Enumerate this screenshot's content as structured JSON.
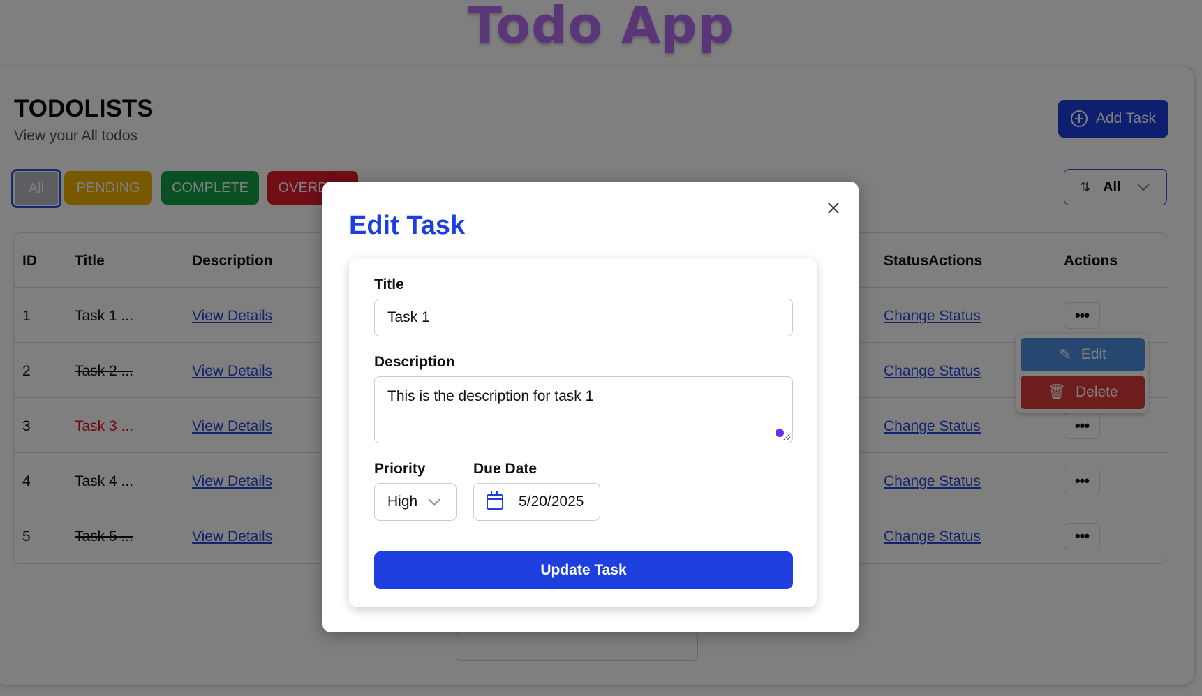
{
  "app_title": "Todo App",
  "page": {
    "heading": "TODOLISTS",
    "subheading": "View your All todos",
    "add_task_label": "Add Task"
  },
  "filters": [
    {
      "label": "All",
      "color": "#b9bcc4"
    },
    {
      "label": "PENDING",
      "color": "#f1b300"
    },
    {
      "label": "COMPLETE",
      "color": "#12a34a"
    },
    {
      "label": "OVERDUE",
      "color": "#e21c2c"
    }
  ],
  "sort": {
    "value": "All",
    "icon": "sort-icon"
  },
  "table": {
    "headers": {
      "id": "ID",
      "title": "Title",
      "description": "Description",
      "status_actions": "StatusActions",
      "actions": "Actions"
    },
    "rows": [
      {
        "id": "1",
        "title": "Task 1 ...",
        "description_link": "View Details",
        "status_link": "Change Status",
        "style": "normal"
      },
      {
        "id": "2",
        "title": "Task 2 ...",
        "description_link": "View Details",
        "status_link": "Change Status",
        "style": "strike"
      },
      {
        "id": "3",
        "title": "Task 3 ...",
        "description_link": "View Details",
        "status_link": "Change Status",
        "style": "overdue"
      },
      {
        "id": "4",
        "title": "Task 4 ...",
        "description_link": "View Details",
        "status_link": "Change Status",
        "style": "normal"
      },
      {
        "id": "5",
        "title": "Task 5 ...",
        "description_link": "View Details",
        "status_link": "Change Status",
        "style": "strike"
      }
    ],
    "row_actions_label": "•••"
  },
  "context_menu": {
    "edit_label": "Edit",
    "delete_label": "Delete"
  },
  "modal": {
    "title": "Edit Task",
    "title_label": "Title",
    "title_value": "Task 1",
    "description_label": "Description",
    "description_value": "This is the description for task 1",
    "priority_label": "Priority",
    "priority_value": "High",
    "due_date_label": "Due Date",
    "due_date_value": "5/20/2025",
    "submit_label": "Update Task"
  },
  "colors": {
    "primary": "#1d3fe0",
    "accent": "#b56cf2",
    "edit": "#4d8fdf",
    "delete": "#dd3b3b"
  }
}
